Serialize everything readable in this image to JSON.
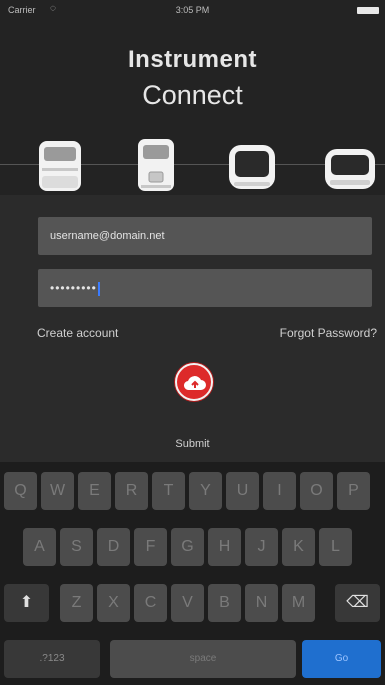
{
  "status_bar": {
    "carrier": "Carrier",
    "wifi_icon": "wifi-icon",
    "time": "3:05 PM",
    "battery_icon": "battery-icon"
  },
  "header": {
    "title_line1": "Instrument",
    "title_line2": "Connect"
  },
  "instruments": [
    "instrument-1-icon",
    "instrument-2-icon",
    "instrument-3-icon",
    "instrument-4-icon"
  ],
  "login": {
    "username_value": "username@domain.net",
    "password_value": "•••••••••",
    "create_account": "Create account",
    "forgot_password": "Forgot Password?",
    "submit_icon": "cloud-upload-icon",
    "submit_label": "Submit",
    "accent": "#dd2a2a"
  },
  "keyboard": {
    "row1": [
      "Q",
      "W",
      "E",
      "R",
      "T",
      "Y",
      "U",
      "I",
      "O",
      "P"
    ],
    "row2": [
      "A",
      "S",
      "D",
      "F",
      "G",
      "H",
      "J",
      "K",
      "L"
    ],
    "row3": [
      "Z",
      "X",
      "C",
      "V",
      "B",
      "N",
      "M"
    ],
    "shift_icon": "shift-icon",
    "delete_icon": "delete-icon",
    "numbers": ".?123",
    "space": "space",
    "go": "Go",
    "go_color": "#1f6fcf"
  }
}
